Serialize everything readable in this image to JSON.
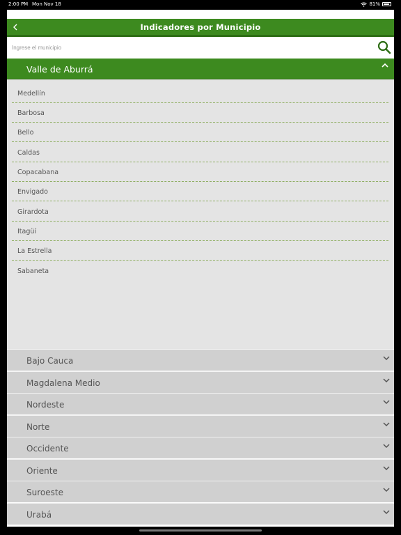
{
  "status_bar": {
    "time": "2:00 PM",
    "date": "Mon Nov 18",
    "battery": "81%"
  },
  "header": {
    "title": "Indicadores por Municipio"
  },
  "search": {
    "placeholder": "Ingrese el municipio"
  },
  "open_region": {
    "label": "Valle de Aburrá",
    "municipios": [
      "Medellín",
      "Barbosa",
      "Bello",
      "Caldas",
      "Copacabana",
      "Envigado",
      "Girardota",
      "Itagüí",
      "La Estrella",
      "Sabaneta"
    ]
  },
  "regions": [
    "Bajo Cauca",
    "Magdalena Medio",
    "Nordeste",
    "Norte",
    "Occidente",
    "Oriente",
    "Suroeste",
    "Urabá"
  ],
  "colors": {
    "accent": "#3d8a1f",
    "list_bg": "#e4e4e4",
    "collapsed_bg": "#d0d0d0",
    "divider": "#8fae62"
  },
  "icons": {
    "back": "chevron-left-icon",
    "search": "search-icon",
    "open": "chevron-up-icon",
    "closed": "chevron-down-icon"
  }
}
